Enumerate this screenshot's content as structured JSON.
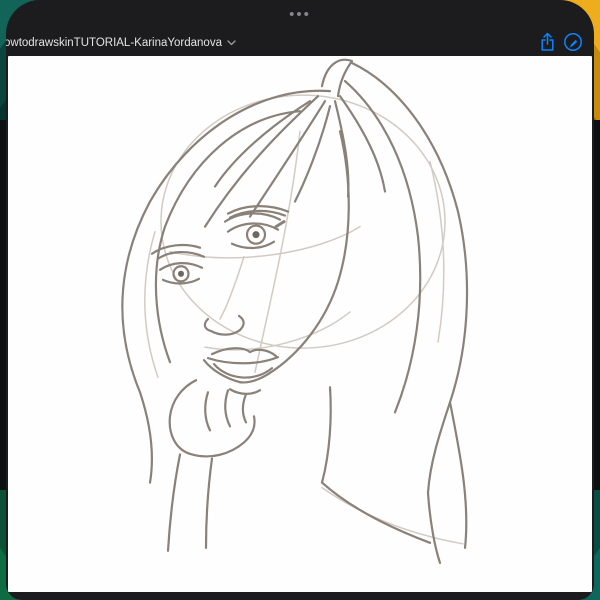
{
  "titlebar": {
    "filename": "owtodrawskinTUTORIAL-KarinaYordanova",
    "drag_dots": "•••"
  },
  "icons": {
    "chevron_down": "chevron-down-icon",
    "share": "share-icon",
    "markup": "markup-circle-icon"
  },
  "colors": {
    "accent": "#0A84FF",
    "chrome": "#1c1c1e",
    "canvas": "#fefefe",
    "sketch_main": "#8a8178",
    "sketch_light": "#d2cbc3"
  },
  "canvas": {
    "content": "pencil sketch of a woman with long hair resting her chin on her hand"
  }
}
